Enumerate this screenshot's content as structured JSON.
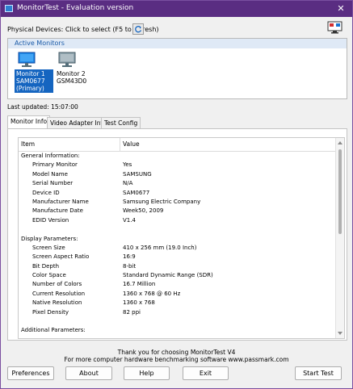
{
  "window": {
    "title": "MonitorTest - Evaluation version",
    "close_label": "✕"
  },
  "physical_devices": {
    "label": "Physical Devices: Click to select (F5 to refresh)"
  },
  "active_monitors": {
    "header": "Active Monitors",
    "monitors": [
      {
        "line1": "Monitor 1",
        "line2": "SAM0677",
        "line3": "(Primary)",
        "selected": true
      },
      {
        "line1": "Monitor 2",
        "line2": "GSM43D0",
        "line3": "",
        "selected": false
      }
    ]
  },
  "last_updated": "Last updated: 15:07:00",
  "tabs": [
    {
      "label": "Monitor Info",
      "active": true
    },
    {
      "label": "Video Adapter Info",
      "active": false
    },
    {
      "label": "Test Config",
      "active": false
    }
  ],
  "grid": {
    "col_item": "Item",
    "col_value": "Value",
    "rows": [
      {
        "type": "section",
        "key": "General Information:",
        "value": ""
      },
      {
        "type": "item",
        "key": "Primary Monitor",
        "value": "Yes"
      },
      {
        "type": "item",
        "key": "Model Name",
        "value": "SAMSUNG"
      },
      {
        "type": "item",
        "key": "Serial Number",
        "value": "N/A"
      },
      {
        "type": "item",
        "key": "Device ID",
        "value": "SAM0677"
      },
      {
        "type": "item",
        "key": "Manufacturer Name",
        "value": "Samsung Electric Company"
      },
      {
        "type": "item",
        "key": "Manufacture Date",
        "value": "Week50, 2009"
      },
      {
        "type": "item",
        "key": "EDID Version",
        "value": "V1.4"
      },
      {
        "type": "blank",
        "key": "",
        "value": ""
      },
      {
        "type": "section",
        "key": "Display Parameters:",
        "value": ""
      },
      {
        "type": "item",
        "key": "Screen Size",
        "value": "410 x 256 mm (19.0 Inch)"
      },
      {
        "type": "item",
        "key": "Screen Aspect Ratio",
        "value": "16:9"
      },
      {
        "type": "item",
        "key": "Bit Depth",
        "value": "8-bit"
      },
      {
        "type": "item",
        "key": "Color Space",
        "value": "Standard Dynamic Range (SDR)"
      },
      {
        "type": "item",
        "key": "Number of Colors",
        "value": "16.7 Million"
      },
      {
        "type": "item",
        "key": "Current Resolution",
        "value": "1360 x 768 @ 60 Hz"
      },
      {
        "type": "item",
        "key": "Native Resolution",
        "value": "1360 x 768"
      },
      {
        "type": "item",
        "key": "Pixel Density",
        "value": "82 ppi"
      },
      {
        "type": "blank",
        "key": "",
        "value": ""
      },
      {
        "type": "section",
        "key": "Additional Parameters:",
        "value": ""
      }
    ]
  },
  "footer": {
    "thanks": "Thank you for choosing MonitorTest V4",
    "more": "For more computer hardware benchmarking software www.passmark.com"
  },
  "buttons": {
    "preferences": "Preferences",
    "about": "About",
    "help": "Help",
    "exit": "Exit",
    "start_test": "Start Test"
  },
  "colors": {
    "titlebar": "#5a2d82",
    "selection": "#1565c0",
    "active_header_text": "#1a5aa8"
  }
}
